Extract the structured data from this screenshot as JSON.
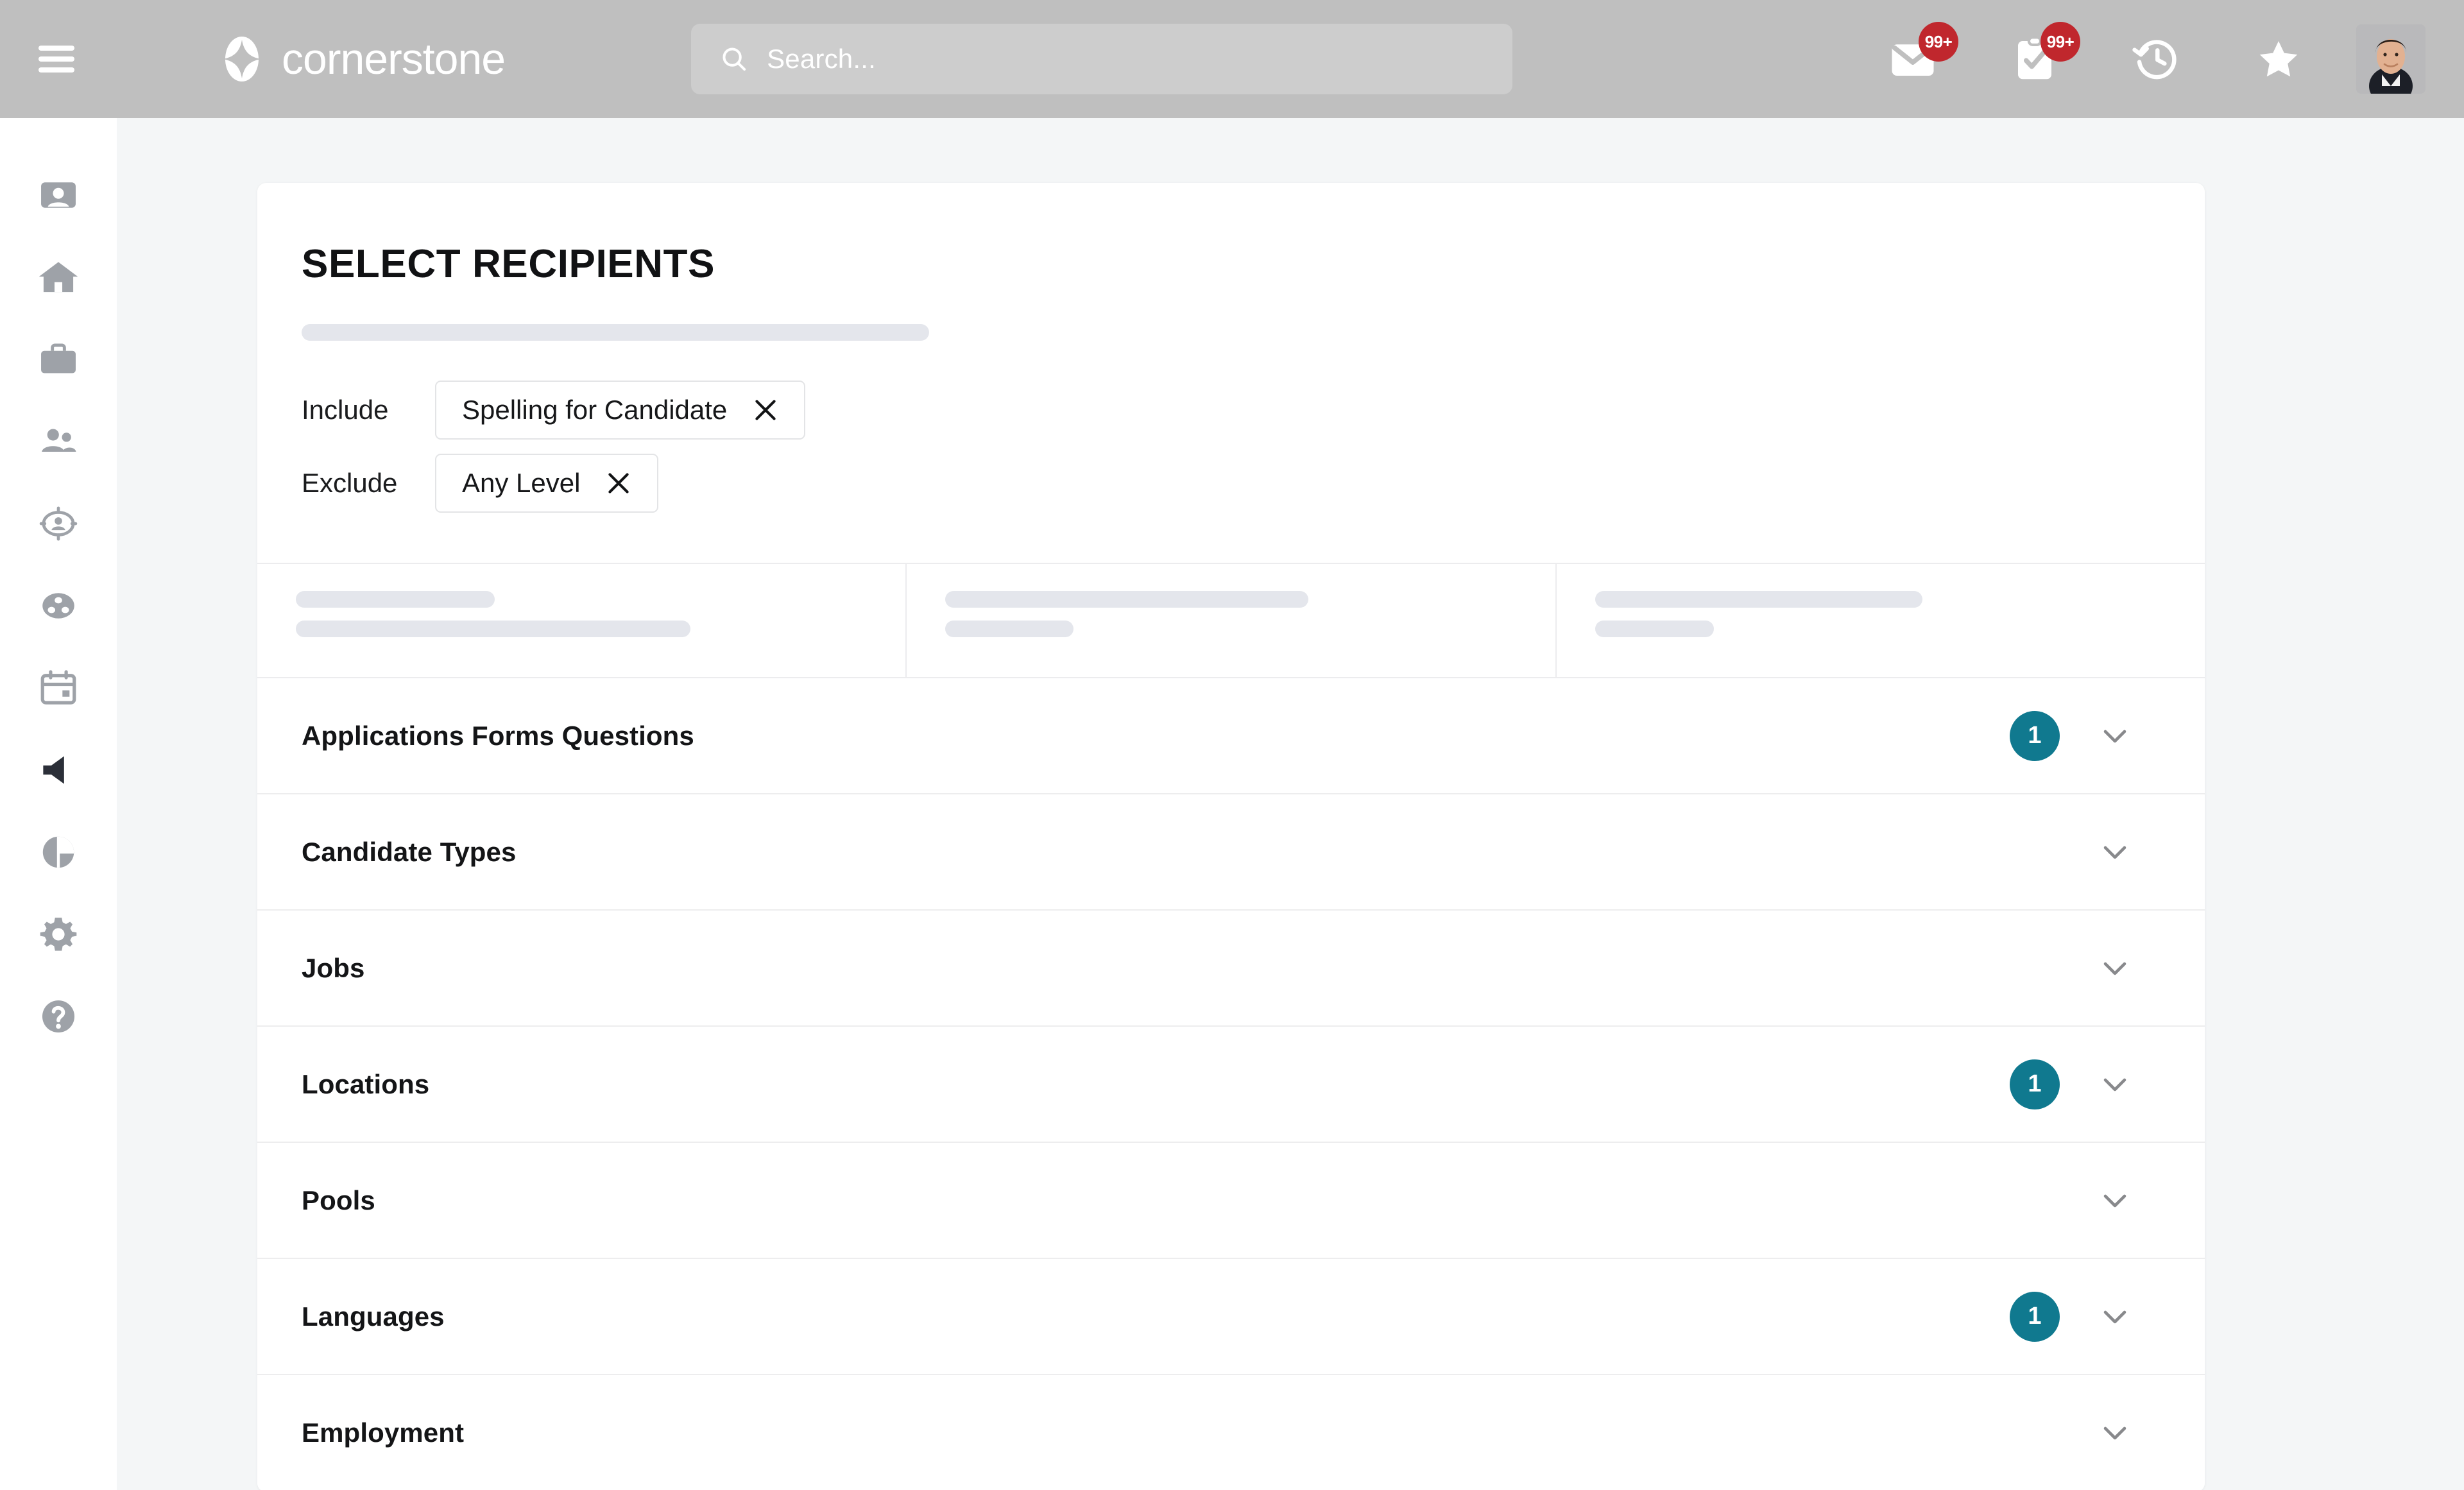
{
  "header": {
    "menu_icon": "hamburger-icon",
    "brand_name": "cornerstone",
    "brand_logo_icon": "cornerstone-star-logo",
    "search": {
      "icon": "search-icon",
      "placeholder": "Search..."
    },
    "actions": [
      {
        "icon": "mail-icon",
        "name": "messages",
        "badge": "99+"
      },
      {
        "icon": "clipboard-check-icon",
        "name": "tasks",
        "badge": "99+"
      },
      {
        "icon": "history-clock-icon",
        "name": "recent",
        "badge": ""
      },
      {
        "icon": "star-icon",
        "name": "favorites",
        "badge": ""
      }
    ],
    "avatar_alt": "user-avatar"
  },
  "sidebar": {
    "items": [
      {
        "icon": "contact-card-icon",
        "name": "profile"
      },
      {
        "icon": "home-icon",
        "name": "home"
      },
      {
        "icon": "briefcase-icon",
        "name": "jobs"
      },
      {
        "icon": "people-icon",
        "name": "people"
      },
      {
        "icon": "recruiting-target-icon",
        "name": "recruiting"
      },
      {
        "icon": "pools-icon",
        "name": "pools"
      },
      {
        "icon": "calendar-icon",
        "name": "calendar"
      },
      {
        "icon": "megaphone-icon",
        "name": "announcements"
      },
      {
        "icon": "pie-chart-icon",
        "name": "reports"
      },
      {
        "icon": "gear-icon",
        "name": "settings"
      },
      {
        "icon": "help-icon",
        "name": "help"
      }
    ]
  },
  "main": {
    "title": "SELECT RECIPIENTS",
    "filters": [
      {
        "label": "Include",
        "chip_label": "Spelling for Candidate",
        "close_icon": "close-icon"
      },
      {
        "label": "Exclude",
        "chip_label": "Any Level",
        "close_icon": "close-icon"
      }
    ],
    "skeleton_columns": [
      {
        "bars": [
          24,
          42
        ]
      },
      {
        "bars": [
          33,
          12
        ]
      },
      {
        "bars": [
          29,
          11
        ]
      }
    ],
    "accordion": [
      {
        "label": "Applications Forms Questions",
        "count": "1",
        "chevron": "chevron-down-icon"
      },
      {
        "label": "Candidate Types",
        "count": "",
        "chevron": "chevron-down-icon"
      },
      {
        "label": "Jobs",
        "count": "",
        "chevron": "chevron-down-icon"
      },
      {
        "label": "Locations",
        "count": "1",
        "chevron": "chevron-down-icon"
      },
      {
        "label": "Pools",
        "count": "",
        "chevron": "chevron-down-icon"
      },
      {
        "label": "Languages",
        "count": "1",
        "chevron": "chevron-down-icon"
      },
      {
        "label": "Employment",
        "count": "",
        "chevron": "chevron-down-icon"
      }
    ]
  },
  "colors": {
    "header_bg": "#bfbfbf",
    "page_bg": "#f4f6f7",
    "accent_teal": "#10798f",
    "badge_red": "#c0272d",
    "skeleton": "#e4e6ec"
  }
}
